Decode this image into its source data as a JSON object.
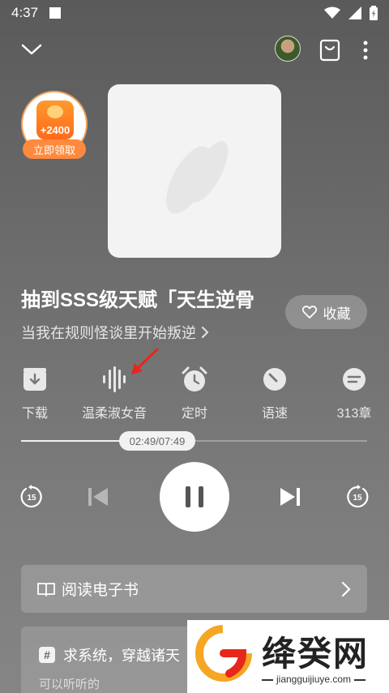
{
  "status": {
    "time": "4:37"
  },
  "promo": {
    "coins": "+2400",
    "claim_label": "立即领取"
  },
  "book": {
    "title": "抽到SSS级天赋「天生逆骨",
    "subtitle": "当我在规则怪谈里开始叛逆"
  },
  "favorite": {
    "label": "收藏"
  },
  "tools": [
    {
      "label": "下载",
      "icon": "download-icon"
    },
    {
      "label": "温柔淑女音",
      "icon": "voice-waveform-icon"
    },
    {
      "label": "定时",
      "icon": "alarm-clock-icon"
    },
    {
      "label": "语速",
      "icon": "speed-dial-icon"
    },
    {
      "label": "313章",
      "icon": "chapter-list-icon"
    }
  ],
  "playback": {
    "time_text": "02:49/07:49",
    "progress": 0.36,
    "skip_back_seconds": "15",
    "skip_forward_seconds": "15"
  },
  "ebook": {
    "label": "阅读电子书"
  },
  "recommend": {
    "title": "求系统，穿越诸天",
    "subtitle": "可以听听的"
  },
  "watermark": {
    "brand": "绛癸网",
    "url": "jiangguijiuye.com"
  },
  "colors": {
    "accent_orange": "#ff8a3d",
    "annotation_red": "#e8261c"
  }
}
